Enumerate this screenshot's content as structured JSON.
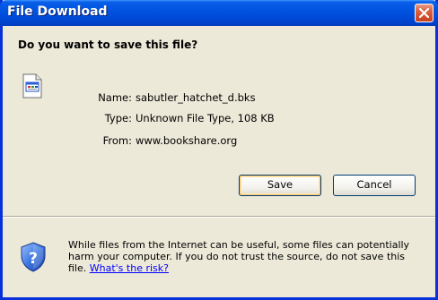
{
  "window": {
    "title": "File Download",
    "close_icon": "close-icon"
  },
  "dialog": {
    "heading": "Do you want to save this file?",
    "file_icon": "unknown-file-icon",
    "fields": [
      {
        "label": "Name:",
        "value": "sabutler_hatchet_d.bks"
      },
      {
        "label": "Type:",
        "value": "Unknown File Type, 108 KB"
      },
      {
        "label": "From:",
        "value": "www.bookshare.org"
      }
    ],
    "buttons": {
      "save": "Save",
      "cancel": "Cancel"
    }
  },
  "warning": {
    "icon": "security-shield-question-icon",
    "line1": "While files from the Internet can be useful, some files can potentially",
    "line2": "harm your computer. If you do not trust the source, do not save this",
    "line3_prefix": "file. ",
    "link": "What's the risk?"
  },
  "colors": {
    "titlebar": "#0053e1",
    "frame": "#0831d9",
    "dialog_bg": "#ece9d8",
    "close_button": "#c8401c",
    "link": "#0000ff"
  }
}
